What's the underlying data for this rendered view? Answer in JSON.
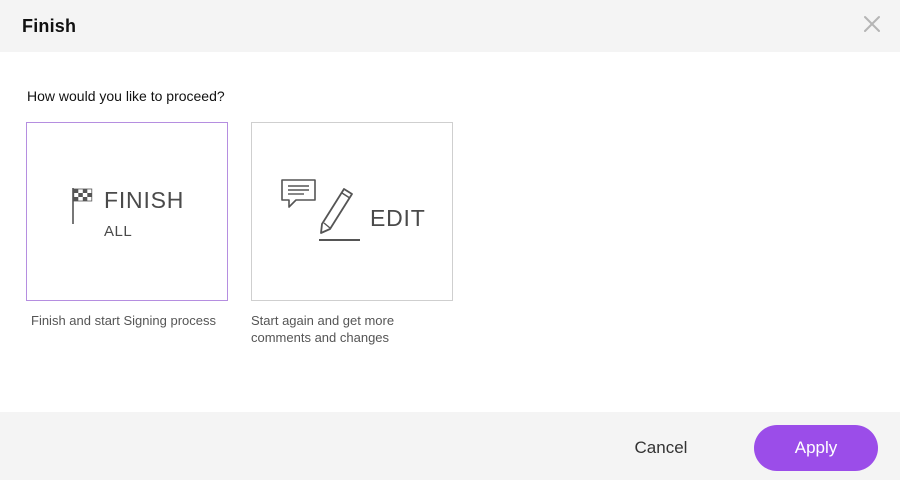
{
  "dialog": {
    "title": "Finish",
    "question": "How would you like to proceed?"
  },
  "options": {
    "finish": {
      "label": "FINISH",
      "sublabel": "ALL",
      "caption": "Finish and start Signing process",
      "icon": "checkered-flag-icon"
    },
    "edit": {
      "label": "EDIT",
      "caption": "Start again and get more comments and changes",
      "icons": [
        "comment-icon",
        "pencil-icon"
      ]
    }
  },
  "footer": {
    "cancel_label": "Cancel",
    "apply_label": "Apply"
  },
  "colors": {
    "accent": "#9b4de9",
    "selected_border": "#b58ee0",
    "header_bg": "#f4f4f4"
  }
}
